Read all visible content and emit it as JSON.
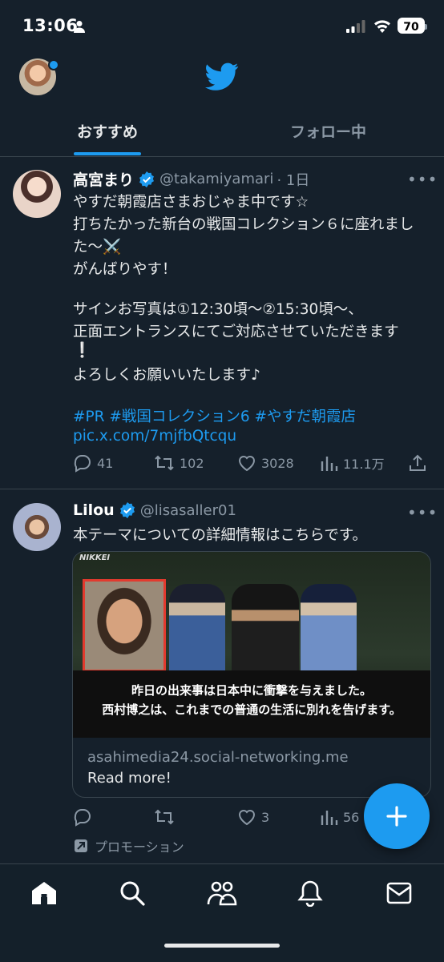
{
  "status_bar": {
    "time": "13:06",
    "battery": "70"
  },
  "tabs": [
    {
      "label": "おすすめ",
      "active": true
    },
    {
      "label": "フォロー中",
      "active": false
    }
  ],
  "tweets": [
    {
      "name": "高宮まり",
      "handle": "@takamiyamari",
      "time": "· 1日",
      "more": "•••",
      "lines": [
        "やすだ朝霞店さまおじゃま中です☆",
        "打ちたかった新台の戦国コレクション６に座れまし",
        "た〜⚔️",
        "がんばりやす！",
        "サインお写真は①12:30頃〜②15:30頃〜、",
        "正面エントランスにてご対応させていただきます",
        "❕",
        "よろしくお願いいたします♪"
      ],
      "hashtags": "#PR #戦国コレクション6 #やすだ朝霞店",
      "pic_link": "pic.x.com/7mjfbQtcqu",
      "stats": {
        "replies": "41",
        "retweets": "102",
        "likes": "3028",
        "views": "11.1万"
      }
    },
    {
      "name": "Lilou",
      "handle": "@lisasaller01",
      "more": "•••",
      "text": "本テーマについての詳細情報はこちらです。",
      "card": {
        "source": "NIKKEI",
        "caption_1": "昨日の出来事は日本中に衝撃を与えました。",
        "caption_2": "西村博之は、これまでの普通の生活に別れを告げます。",
        "domain": "asahimedia24.social-networking.me",
        "cta": "Read more!"
      },
      "stats": {
        "likes": "3",
        "views": "56"
      },
      "promo_label": "プロモーション"
    }
  ],
  "colors": {
    "accent": "#1d9bf0",
    "background": "#15202b",
    "divider": "#38444d",
    "muted": "#8b98a5"
  },
  "icons": [
    "home-icon",
    "search-icon",
    "communities-icon",
    "bell-icon",
    "mail-icon",
    "compose-icon"
  ]
}
